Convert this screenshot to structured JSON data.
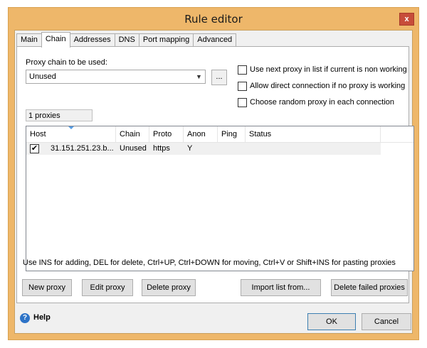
{
  "window": {
    "title": "Rule editor",
    "close_glyph": "x"
  },
  "tabs": [
    "Main",
    "Chain",
    "Addresses",
    "DNS",
    "Port mapping",
    "Advanced"
  ],
  "active_tab": "Chain",
  "chain": {
    "label": "Proxy chain to be used:",
    "selected": "Unused",
    "browse_label": "...",
    "count_text": "1 proxies"
  },
  "options": {
    "next_proxy": "Use next proxy in list if current is non working",
    "direct": "Allow direct connection if no proxy is working",
    "random": "Choose random proxy in each connection"
  },
  "table": {
    "columns": [
      "Host",
      "Chain",
      "Proto",
      "Anon",
      "Ping",
      "Status"
    ],
    "rows": [
      {
        "checked": true,
        "host": "31.151.251.23.b...",
        "chain": "Unused",
        "proto": "https",
        "anon": "Y",
        "ping": "",
        "status": ""
      }
    ]
  },
  "hint": "Use INS for adding, DEL for delete, Ctrl+UP, Ctrl+DOWN for moving, Ctrl+V or Shift+INS for pasting proxies",
  "buttons": {
    "new_proxy": "New proxy",
    "edit_proxy": "Edit proxy",
    "delete_proxy": "Delete proxy",
    "import": "Import list from...",
    "delete_failed": "Delete failed proxies",
    "ok": "OK",
    "cancel": "Cancel"
  },
  "help": {
    "label": "Help",
    "icon_glyph": "?"
  },
  "colors": {
    "frame": "#eeb76a",
    "close": "#c74d3a",
    "help_icon": "#2d73c7"
  }
}
